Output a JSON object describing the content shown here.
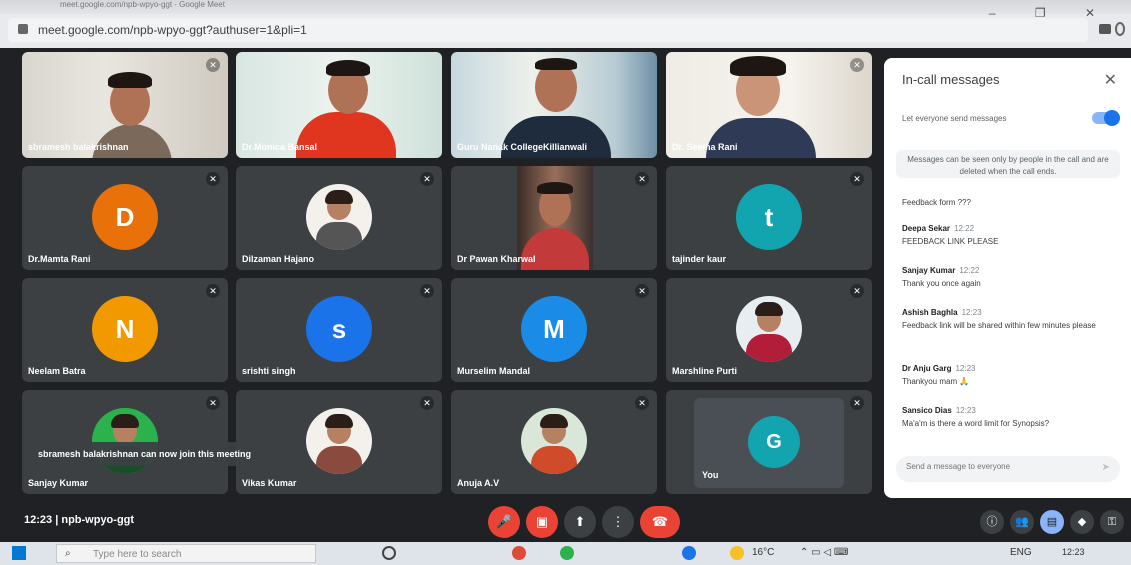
{
  "browser": {
    "tab_text": "meet.google.com/npb-wpyo-ggt - Google Meet",
    "url": "meet.google.com/npb-wpyo-ggt?authuser=1&pli=1",
    "window_controls": "– ❐ ✕"
  },
  "tiles": [
    {
      "name": "sbramesh balakrishnan",
      "type": "camera"
    },
    {
      "name": "Dr.Monica Bansal",
      "type": "camera"
    },
    {
      "name": "Guru Nanak CollegeKillianwali",
      "type": "camera"
    },
    {
      "name": "Dr. Seema Rani",
      "type": "camera"
    },
    {
      "name": "Dr.Mamta Rani",
      "type": "initial",
      "initial": "D",
      "color": "#e8710a"
    },
    {
      "name": "Dilzaman Hajano",
      "type": "photo"
    },
    {
      "name": "Dr Pawan Kharwal",
      "type": "camera"
    },
    {
      "name": "tajinder kaur",
      "type": "initial",
      "initial": "t",
      "color": "#12a4af"
    },
    {
      "name": "Neelam Batra",
      "type": "initial",
      "initial": "N",
      "color": "#f29900"
    },
    {
      "name": "srishti singh",
      "type": "initial",
      "initial": "s",
      "color": "#1a73e8"
    },
    {
      "name": "Murselim Mandal",
      "type": "initial",
      "initial": "M",
      "color": "#1a8ce8"
    },
    {
      "name": "Marshline Purti",
      "type": "photo"
    },
    {
      "name": "Sanjay Kumar",
      "type": "photo"
    },
    {
      "name": "Vikas Kumar",
      "type": "photo"
    },
    {
      "name": "Anuja A.V",
      "type": "photo"
    },
    {
      "name": "You",
      "type": "initial",
      "initial": "G",
      "color": "#12a4af"
    }
  ],
  "toast": "sbramesh balakrishnan can now join this meeting",
  "chat": {
    "title": "In-call messages",
    "close": "✕",
    "let_everyone": "Let everyone send messages",
    "notice": "Messages can be seen only by people in the call and are deleted when the call ends.",
    "messages": [
      {
        "sender": "",
        "time": "",
        "text": "Feedback form ???"
      },
      {
        "sender": "Deepa Sekar",
        "time": "12:22",
        "text": "FEEDBACK LINK PLEASE"
      },
      {
        "sender": "Sanjay Kumar",
        "time": "12:22",
        "text": "Thank you once again"
      },
      {
        "sender": "Ashish Baghla",
        "time": "12:23",
        "text": "Feedback link will be shared within few minutes please"
      },
      {
        "sender": "Dr Anju Garg",
        "time": "12:23",
        "text": "Thankyou mam 🙏"
      },
      {
        "sender": "Sansico Dias",
        "time": "12:23",
        "text": "Ma'a'm is there a word limit for Synopsis?"
      }
    ],
    "input_placeholder": "Send a message to everyone",
    "send_icon": "send-icon"
  },
  "controls": {
    "time": "12:23",
    "meeting_code": "npb-wpyo-ggt"
  },
  "taskbar": {
    "search_placeholder": "Type here to search",
    "temperature": "16°C",
    "language": "ENG",
    "clock": "12:23"
  }
}
